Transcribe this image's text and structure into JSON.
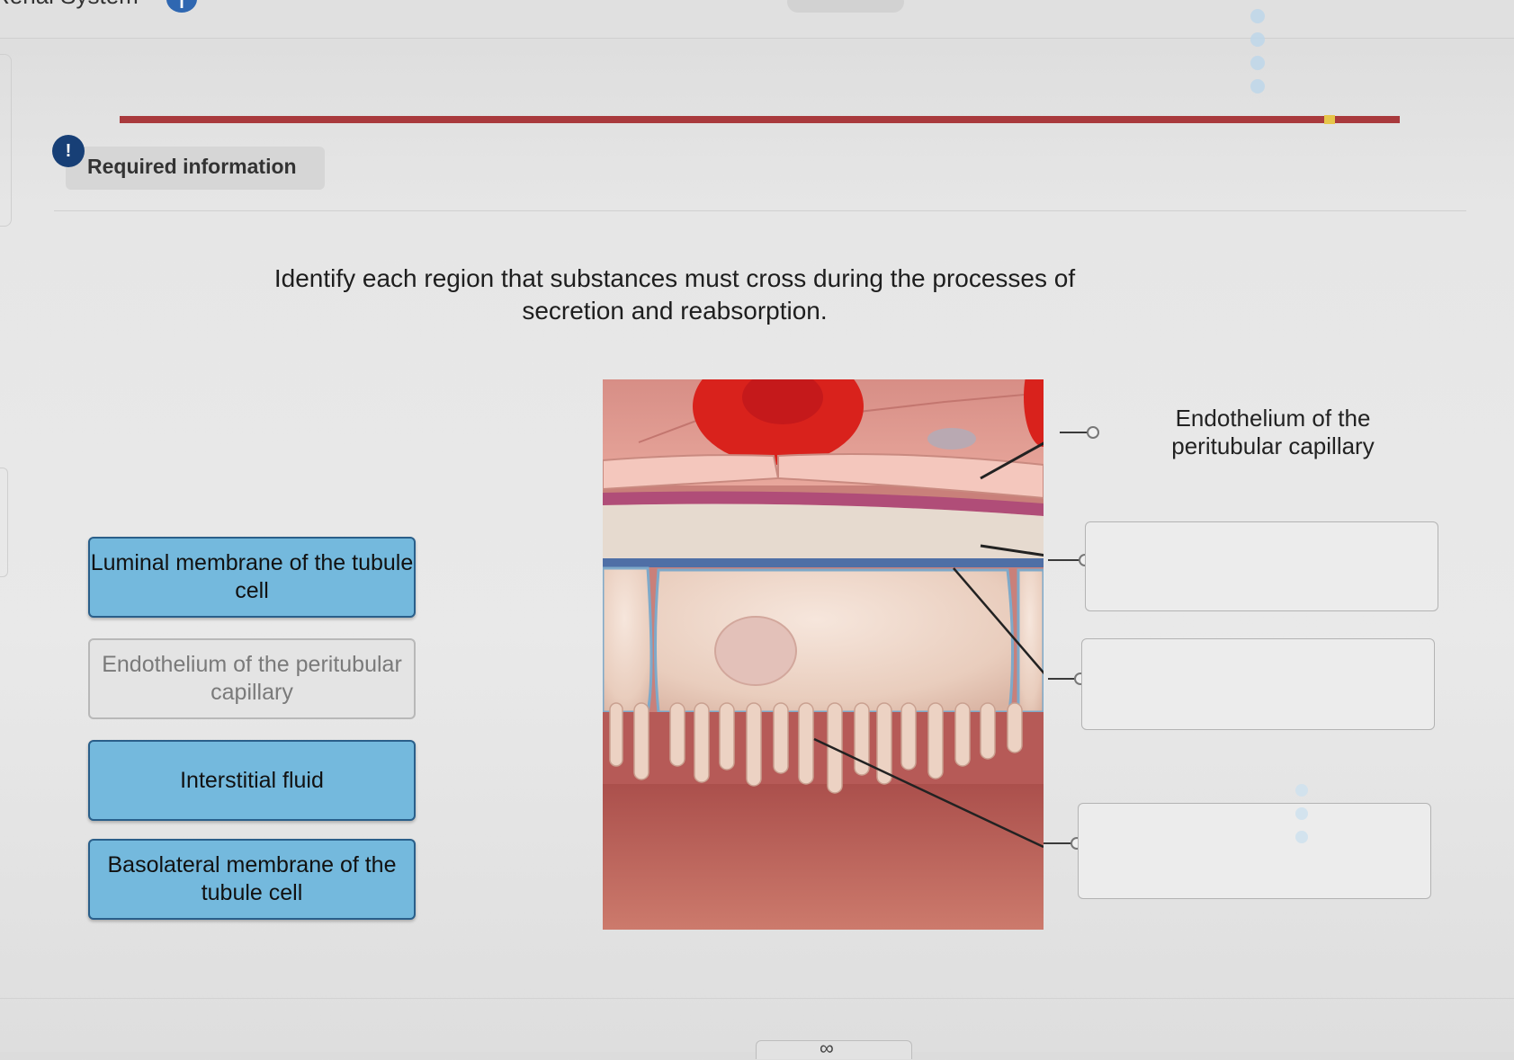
{
  "header": {
    "title_fragment": "Renal System",
    "info_icon": "info-icon"
  },
  "alert": {
    "icon_glyph": "!",
    "label": "Required information"
  },
  "question": {
    "text": "Identify each region that substances must cross during the processes of secretion and reabsorption."
  },
  "label_bank": [
    {
      "text": "Luminal membrane of the tubule cell",
      "state": "available"
    },
    {
      "text": "Endothelium of the peritubular capillary",
      "state": "used"
    },
    {
      "text": "Interstitial fluid",
      "state": "available"
    },
    {
      "text": "Basolateral membrane of the tubule cell",
      "state": "available"
    }
  ],
  "targets": [
    {
      "text": "Endothelium of the peritubular capillary"
    },
    {
      "text": ""
    },
    {
      "text": ""
    },
    {
      "text": ""
    }
  ],
  "colors": {
    "progress": "#a93a3d",
    "label_active": "#74b9dd",
    "label_border": "#2a5f8a",
    "alert_icon": "#173f76"
  }
}
